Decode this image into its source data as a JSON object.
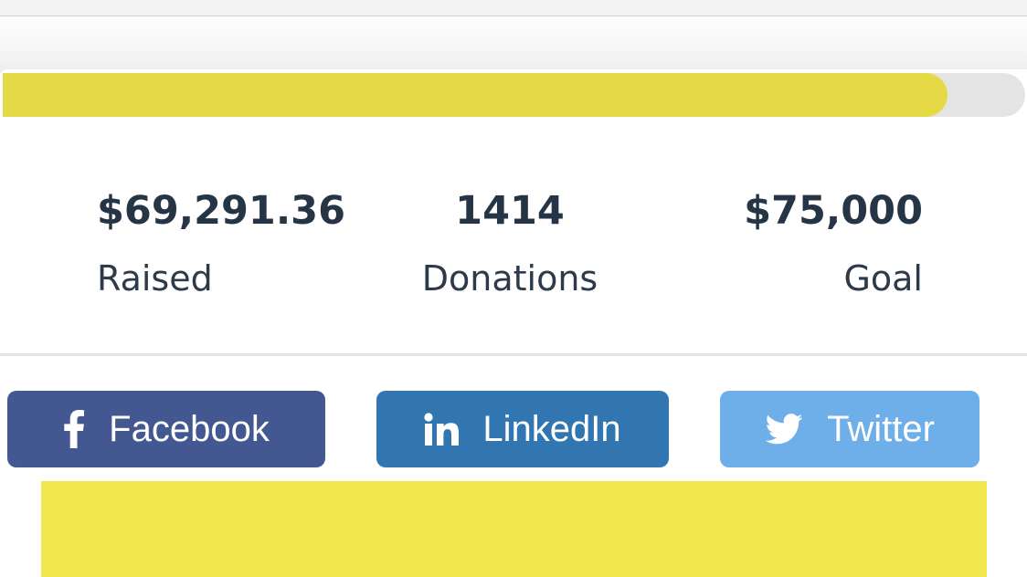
{
  "progress": {
    "fraction": 0.924,
    "fill_color": "#e5da45",
    "track_color": "#e4e4e4"
  },
  "stats": {
    "raised": {
      "value": "$69,291.36",
      "label": "Raised"
    },
    "donations": {
      "value": "1414",
      "label": "Donations"
    },
    "goal": {
      "value": "$75,000",
      "label": "Goal"
    }
  },
  "share": {
    "facebook": {
      "label": "Facebook",
      "icon": "facebook-icon",
      "color": "#435891"
    },
    "linkedin": {
      "label": "LinkedIn",
      "icon": "linkedin-icon",
      "color": "#3276b1"
    },
    "twitter": {
      "label": "Twitter",
      "icon": "twitter-icon",
      "color": "#6eaee9"
    }
  },
  "colors": {
    "text": "#263546",
    "donate_block": "#f2e74f"
  }
}
